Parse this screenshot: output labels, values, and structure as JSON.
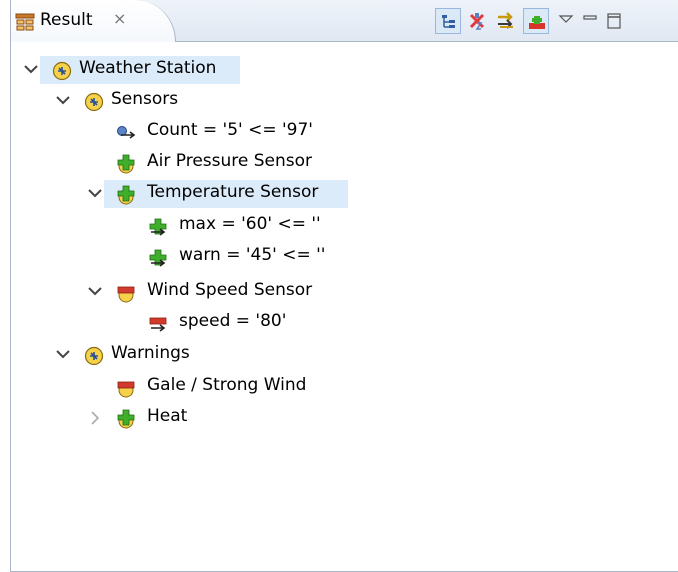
{
  "view": {
    "tab_title": "Result",
    "tab_close_glyph": "×",
    "tab_icon": "result-view-icon",
    "toolbar": [
      {
        "name": "tree-layout-button",
        "icon": "tree-layout-icon",
        "selected": true
      },
      {
        "name": "remove-all-button",
        "icon": "remove-icon",
        "selected": false
      },
      {
        "name": "expand-button",
        "icon": "expand-arrows-icon",
        "selected": false
      },
      {
        "name": "link-button",
        "icon": "link-icon",
        "selected": true
      },
      {
        "name": "view-menu-button",
        "icon": "view-menu-icon",
        "selected": false
      },
      {
        "name": "minimize-button",
        "icon": "minimize-icon",
        "selected": false
      },
      {
        "name": "maximize-button",
        "icon": "maximize-icon",
        "selected": false
      }
    ]
  },
  "tree": [
    {
      "label": "Weather Station",
      "icon": "variable-icon",
      "twisty": "expanded",
      "selected": true
    },
    {
      "label": "Sensors",
      "icon": "variable-icon",
      "twisty": "expanded",
      "selected": false
    },
    {
      "label": "Count = '5' <= '97'",
      "icon": "attribute-arrow-icon",
      "twisty": "none",
      "selected": false
    },
    {
      "label": "Air Pressure Sensor",
      "icon": "green-plus-icon",
      "twisty": "none",
      "selected": false
    },
    {
      "label": "Temperature Sensor",
      "icon": "green-plus-icon",
      "twisty": "expanded",
      "selected": true
    },
    {
      "label": "max = '60' <= ''",
      "icon": "green-arrow-icon",
      "twisty": "none",
      "selected": false
    },
    {
      "label": "warn = '45' <= ''",
      "icon": "green-arrow-icon",
      "twisty": "none",
      "selected": false
    },
    {
      "label": "Wind Speed Sensor",
      "icon": "red-minus-icon",
      "twisty": "expanded",
      "selected": false
    },
    {
      "label": "speed = '80'",
      "icon": "red-arrow-icon",
      "twisty": "none",
      "selected": false
    },
    {
      "label": "Warnings",
      "icon": "variable-icon",
      "twisty": "expanded",
      "selected": false
    },
    {
      "label": "Gale / Strong Wind",
      "icon": "red-minus-icon",
      "twisty": "none",
      "selected": false
    },
    {
      "label": "Heat",
      "icon": "green-plus-icon",
      "twisty": "collapsed",
      "selected": false
    }
  ],
  "colors": {
    "selection": "#dcebfa",
    "border": "#a9b6c8",
    "green": "#3fae2a",
    "red": "#d23b2b",
    "yellow": "#f5d24a"
  }
}
